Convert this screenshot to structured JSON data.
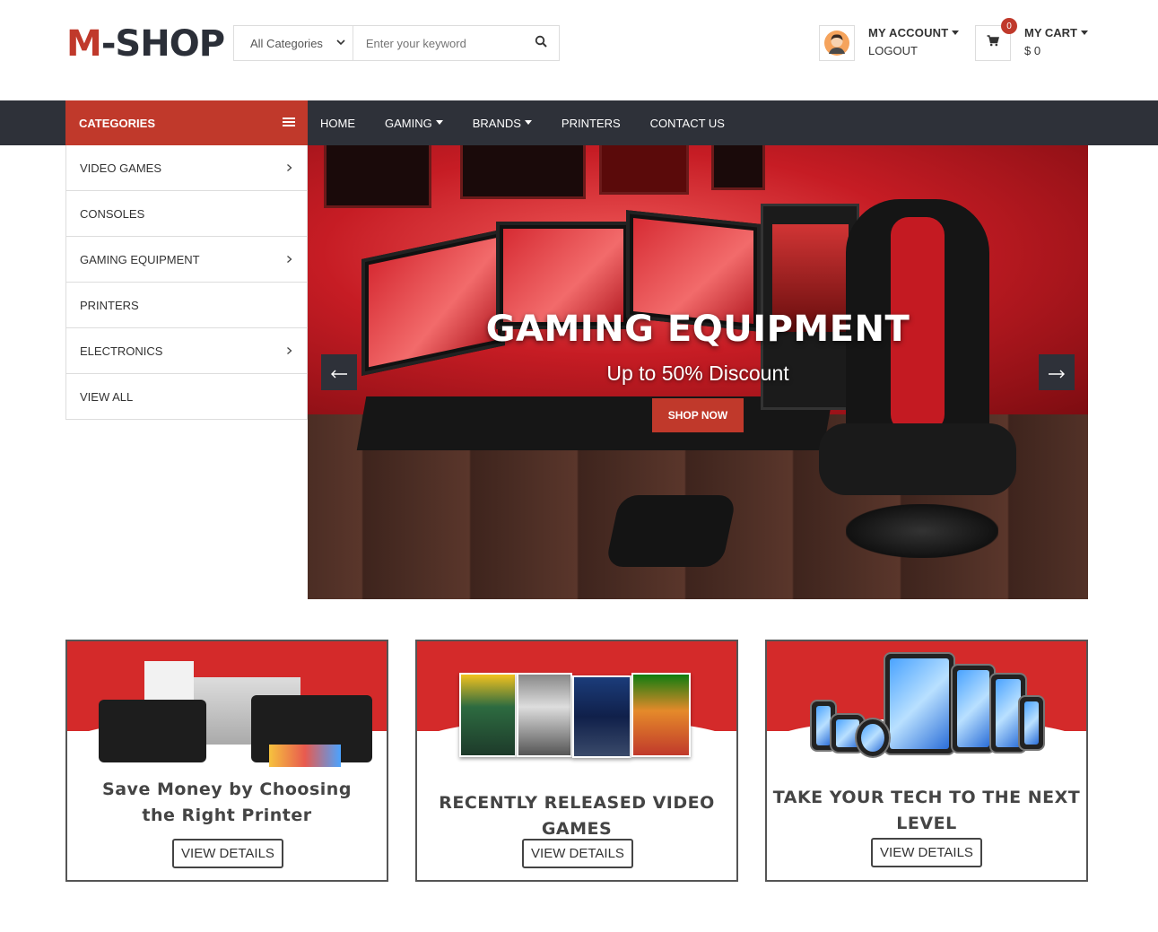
{
  "header": {
    "logo_m": "M",
    "logo_rest": "-SHOP",
    "search": {
      "category": "All Categories",
      "placeholder": "Enter your keyword"
    },
    "account": {
      "title": "MY ACCOUNT",
      "subtitle": "LOGOUT"
    },
    "cart": {
      "count": "0",
      "title": "MY CART",
      "total": "$ 0"
    }
  },
  "nav": {
    "categories_label": "CATEGORIES",
    "items": [
      {
        "label": "HOME"
      },
      {
        "label": "GAMING"
      },
      {
        "label": "BRANDS"
      },
      {
        "label": "PRINTERS"
      },
      {
        "label": "CONTACT US"
      }
    ]
  },
  "sidebar": {
    "items": [
      {
        "label": "VIDEO GAMES"
      },
      {
        "label": "CONSOLES"
      },
      {
        "label": "GAMING EQUIPMENT"
      },
      {
        "label": "PRINTERS"
      },
      {
        "label": "ELECTRONICS"
      },
      {
        "label": "VIEW ALL"
      }
    ]
  },
  "hero": {
    "title": "GAMING EQUIPMENT",
    "subtitle": "Up to 50% Discount",
    "cta": "SHOP NOW",
    "prev_icon": "arrow-left-icon",
    "next_icon": "arrow-right-icon"
  },
  "cards": [
    {
      "line1": "Save Money by Choosing",
      "line2": "the Right Printer",
      "button": "VIEW DETAILS"
    },
    {
      "line1": "RECENTLY RELEASED VIDEO GAMES",
      "button": "VIEW DETAILS"
    },
    {
      "line1": "TAKE YOUR TECH TO THE NEXT LEVEL",
      "button": "VIEW DETAILS"
    }
  ],
  "colors": {
    "accent": "#c0392b",
    "navbar": "#2e3139"
  }
}
